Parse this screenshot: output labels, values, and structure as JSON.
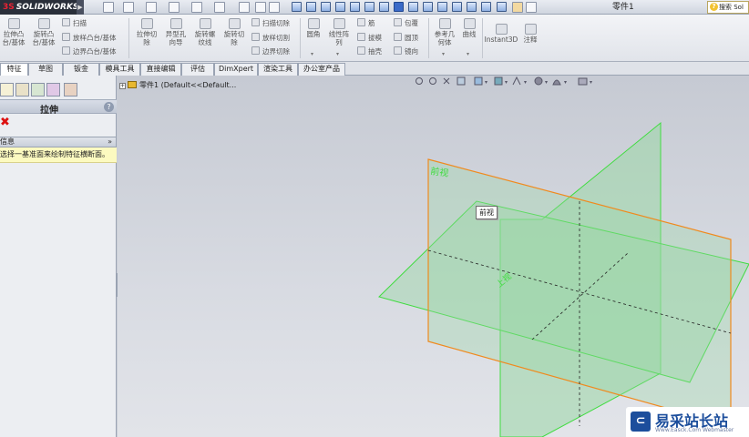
{
  "app": {
    "logo": "SOLIDWORKS",
    "document_title": "零件1",
    "search_placeholder": "搜索 Sol"
  },
  "ribbon": {
    "extrude_boss": "拉伸凸\n台/基体",
    "revolve_boss": "旋转凸\n台/基体",
    "sweep": "扫描",
    "loft": "放样凸台/基体",
    "boundary_boss": "边界凸台/基体",
    "extrude_cut": "拉伸切\n除",
    "hole_wizard": "异型孔\n向导",
    "revolve_cut_thread": "旋转螺\n纹线",
    "revolve_cut": "旋转切\n除",
    "swept_cut": "扫描切除",
    "lofted_cut": "放样切割",
    "boundary_cut": "边界切除",
    "fillet": "圆角",
    "linear_pattern": "线性阵\n列",
    "rib": "筋",
    "draft": "拔模",
    "shell": "抽壳",
    "wrap": "包覆",
    "dome": "圆顶",
    "mirror": "镜向",
    "ref_geometry": "参考几\n何体",
    "curves": "曲线",
    "instant3d": "Instant3D",
    "annotation": "注释"
  },
  "tabs": [
    "特征",
    "草图",
    "钣金",
    "模具工具",
    "直接编辑",
    "评估",
    "DimXpert",
    "渲染工具",
    "办公室产品"
  ],
  "active_tab": "特征",
  "property_manager": {
    "title": "拉伸",
    "help": "?",
    "close": "✖",
    "message_title": "信息",
    "message_collapse": "»",
    "message": "选择一基准面来绘制特征横断面。"
  },
  "tree": {
    "expand": "+",
    "item": "零件1  (Default<<Default..."
  },
  "planes": {
    "front": "前视",
    "top": "上视"
  },
  "tooltip": "前视",
  "watermark": {
    "logo_glyph": "⊂",
    "text": "易采站长站",
    "sub": "Www.Easck.Com Webmaster"
  },
  "colors": {
    "plane_fill": "#9bd7a6",
    "plane_edge": "#3fdc3f",
    "selected_edge": "#f08a1e",
    "brand": "#1c4e9c"
  }
}
